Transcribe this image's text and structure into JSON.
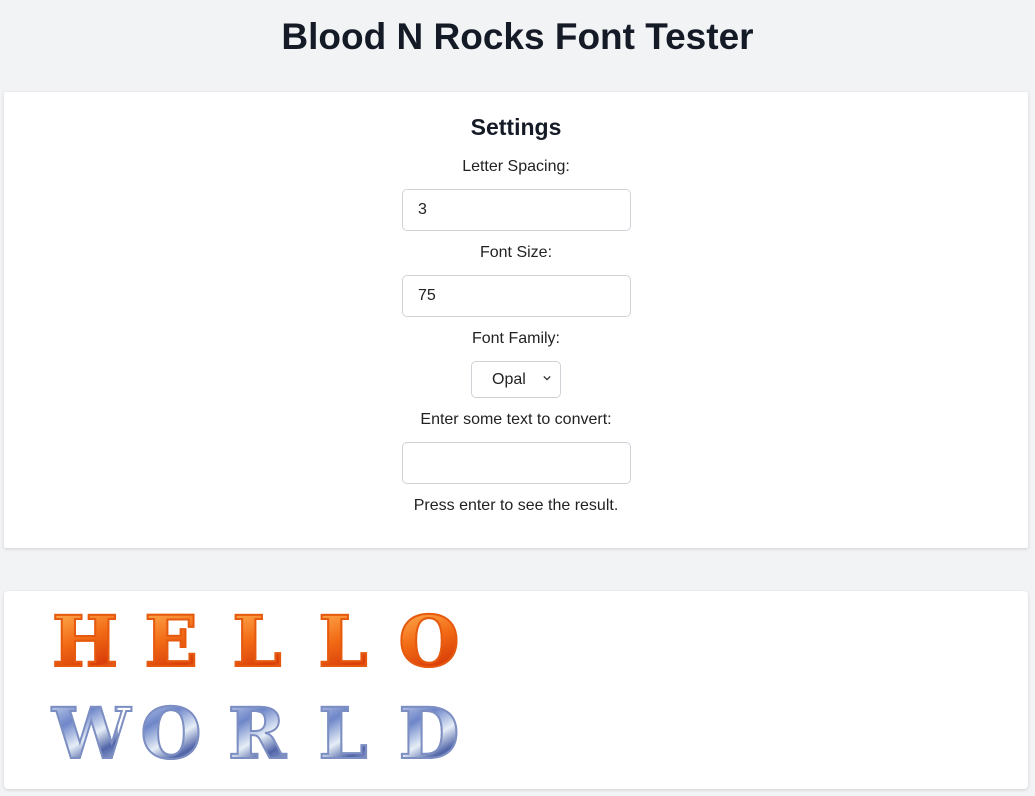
{
  "page": {
    "title": "Blood N Rocks Font Tester"
  },
  "settings": {
    "heading": "Settings",
    "letter_spacing": {
      "label": "Letter Spacing:",
      "value": "3"
    },
    "font_size": {
      "label": "Font Size:",
      "value": "75"
    },
    "font_family": {
      "label": "Font Family:",
      "selected": "Opal"
    },
    "text_input": {
      "label": "Enter some text to convert:",
      "value": ""
    },
    "hint": "Press enter to see the result."
  },
  "result": {
    "row1": {
      "style": "amber",
      "letters": [
        "H",
        "E",
        "L",
        "L",
        "O"
      ]
    },
    "row2": {
      "style": "opal",
      "letters": [
        "W",
        "O",
        "R",
        "L",
        "D"
      ]
    }
  },
  "icons": {
    "select_arrow": "chevron-down-icon"
  }
}
